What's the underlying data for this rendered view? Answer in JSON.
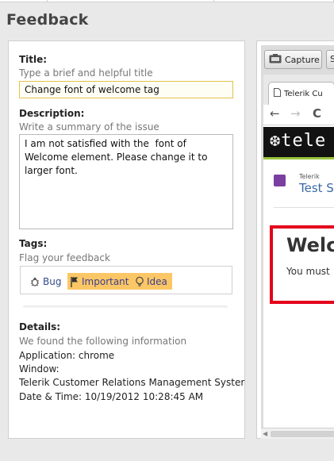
{
  "window_title": "Feedback",
  "form": {
    "title_label": "Title:",
    "title_hint": "Type a brief and helpful title",
    "title_value": "Change font of welcome tag",
    "description_label": "Description:",
    "description_hint": "Write a summary of the issue",
    "description_value": "I am not satisfied with the  font of Welcome element. Please change it to larger font.",
    "tags_label": "Tags:",
    "tags_hint": "Flag your feedback",
    "tags": [
      {
        "label": "Bug",
        "icon": "bug-icon",
        "selected": false
      },
      {
        "label": "Important",
        "icon": "flag-icon",
        "selected": true
      },
      {
        "label": "Idea",
        "icon": "lightbulb-icon",
        "selected": true
      }
    ],
    "details_label": "Details:",
    "details_hint": "We found the following information",
    "details_application": "Application: chrome",
    "details_window_label": "Window:",
    "details_window_value": "Telerik Customer Relations Management Syster",
    "details_datetime": "Date & Time: 10/19/2012 10:28:45 AM"
  },
  "preview": {
    "capture_label": "Capture",
    "second_button_label": "S",
    "browser_tab_title": "Telerik Cu",
    "nav_back": "←",
    "nav_forward": "→",
    "nav_reload": "C",
    "brand_text": "❆tele",
    "logo_small": "Telerik",
    "logo_big": "Test S",
    "welcome_heading": "Welc",
    "welcome_subtext": "You must",
    "scroll_arrow": "◀"
  },
  "colors": {
    "tag_selected_bg": "#fbc766",
    "title_field_border": "#e2c24c",
    "highlight_border": "#e3001b",
    "brand_accent": "#9ac43d"
  }
}
